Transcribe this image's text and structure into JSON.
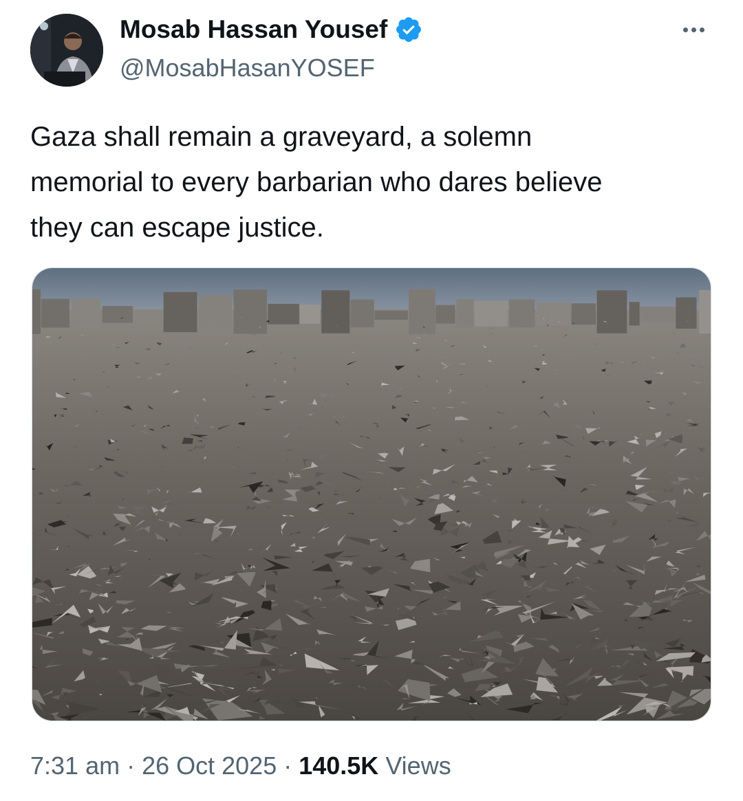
{
  "author": {
    "display_name": "Mosab Hassan Yousef",
    "handle": "@MosabHasanYOSEF",
    "verified": true,
    "verified_color": "#1d9bf0",
    "avatar_icon": "profile-photo"
  },
  "more_icon": "more-horizontal-icon",
  "tweet": {
    "text": "Gaza shall remain a graveyard, a solemn\nmemorial to every barbarian who dares believe\nthey can escape justice."
  },
  "media": {
    "type": "photo",
    "icon": "rubble-landscape-photo"
  },
  "meta": {
    "time": "7:31 am",
    "separator": "·",
    "date": "26 Oct 2025",
    "views_count": "140.5K",
    "views_label": "Views"
  },
  "colors": {
    "text_primary": "#0f1419",
    "text_secondary": "#536471",
    "border": "#cfd9de"
  }
}
